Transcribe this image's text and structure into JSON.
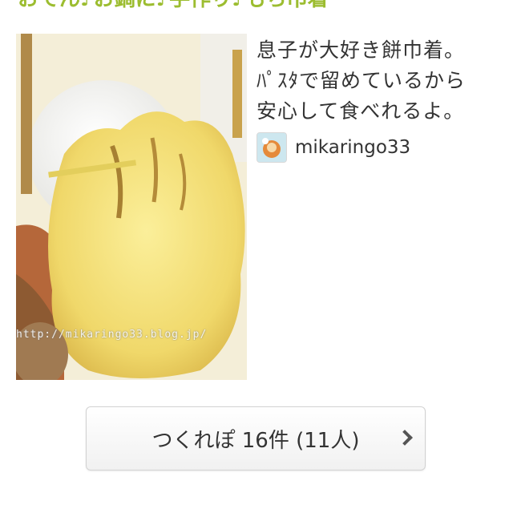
{
  "recipe": {
    "title": "おでん♪お鍋に♪手作り♪もち巾着",
    "photo_watermark": "http://mikaringo33.blog.jp/",
    "description": "息子が大好き餅巾着。\nﾊﾟｽﾀで留めているから\n安心して食べれるよ。"
  },
  "author": {
    "name": "mikaringo33",
    "avatar_icon": "user-avatar-icon"
  },
  "tsukurepo": {
    "label": "つくれぽ 16件 (11人)",
    "chevron_icon": "chevron-right-icon"
  },
  "colors": {
    "title": "#9cbd30",
    "text": "#333333",
    "button_border": "#d2d2d2"
  }
}
